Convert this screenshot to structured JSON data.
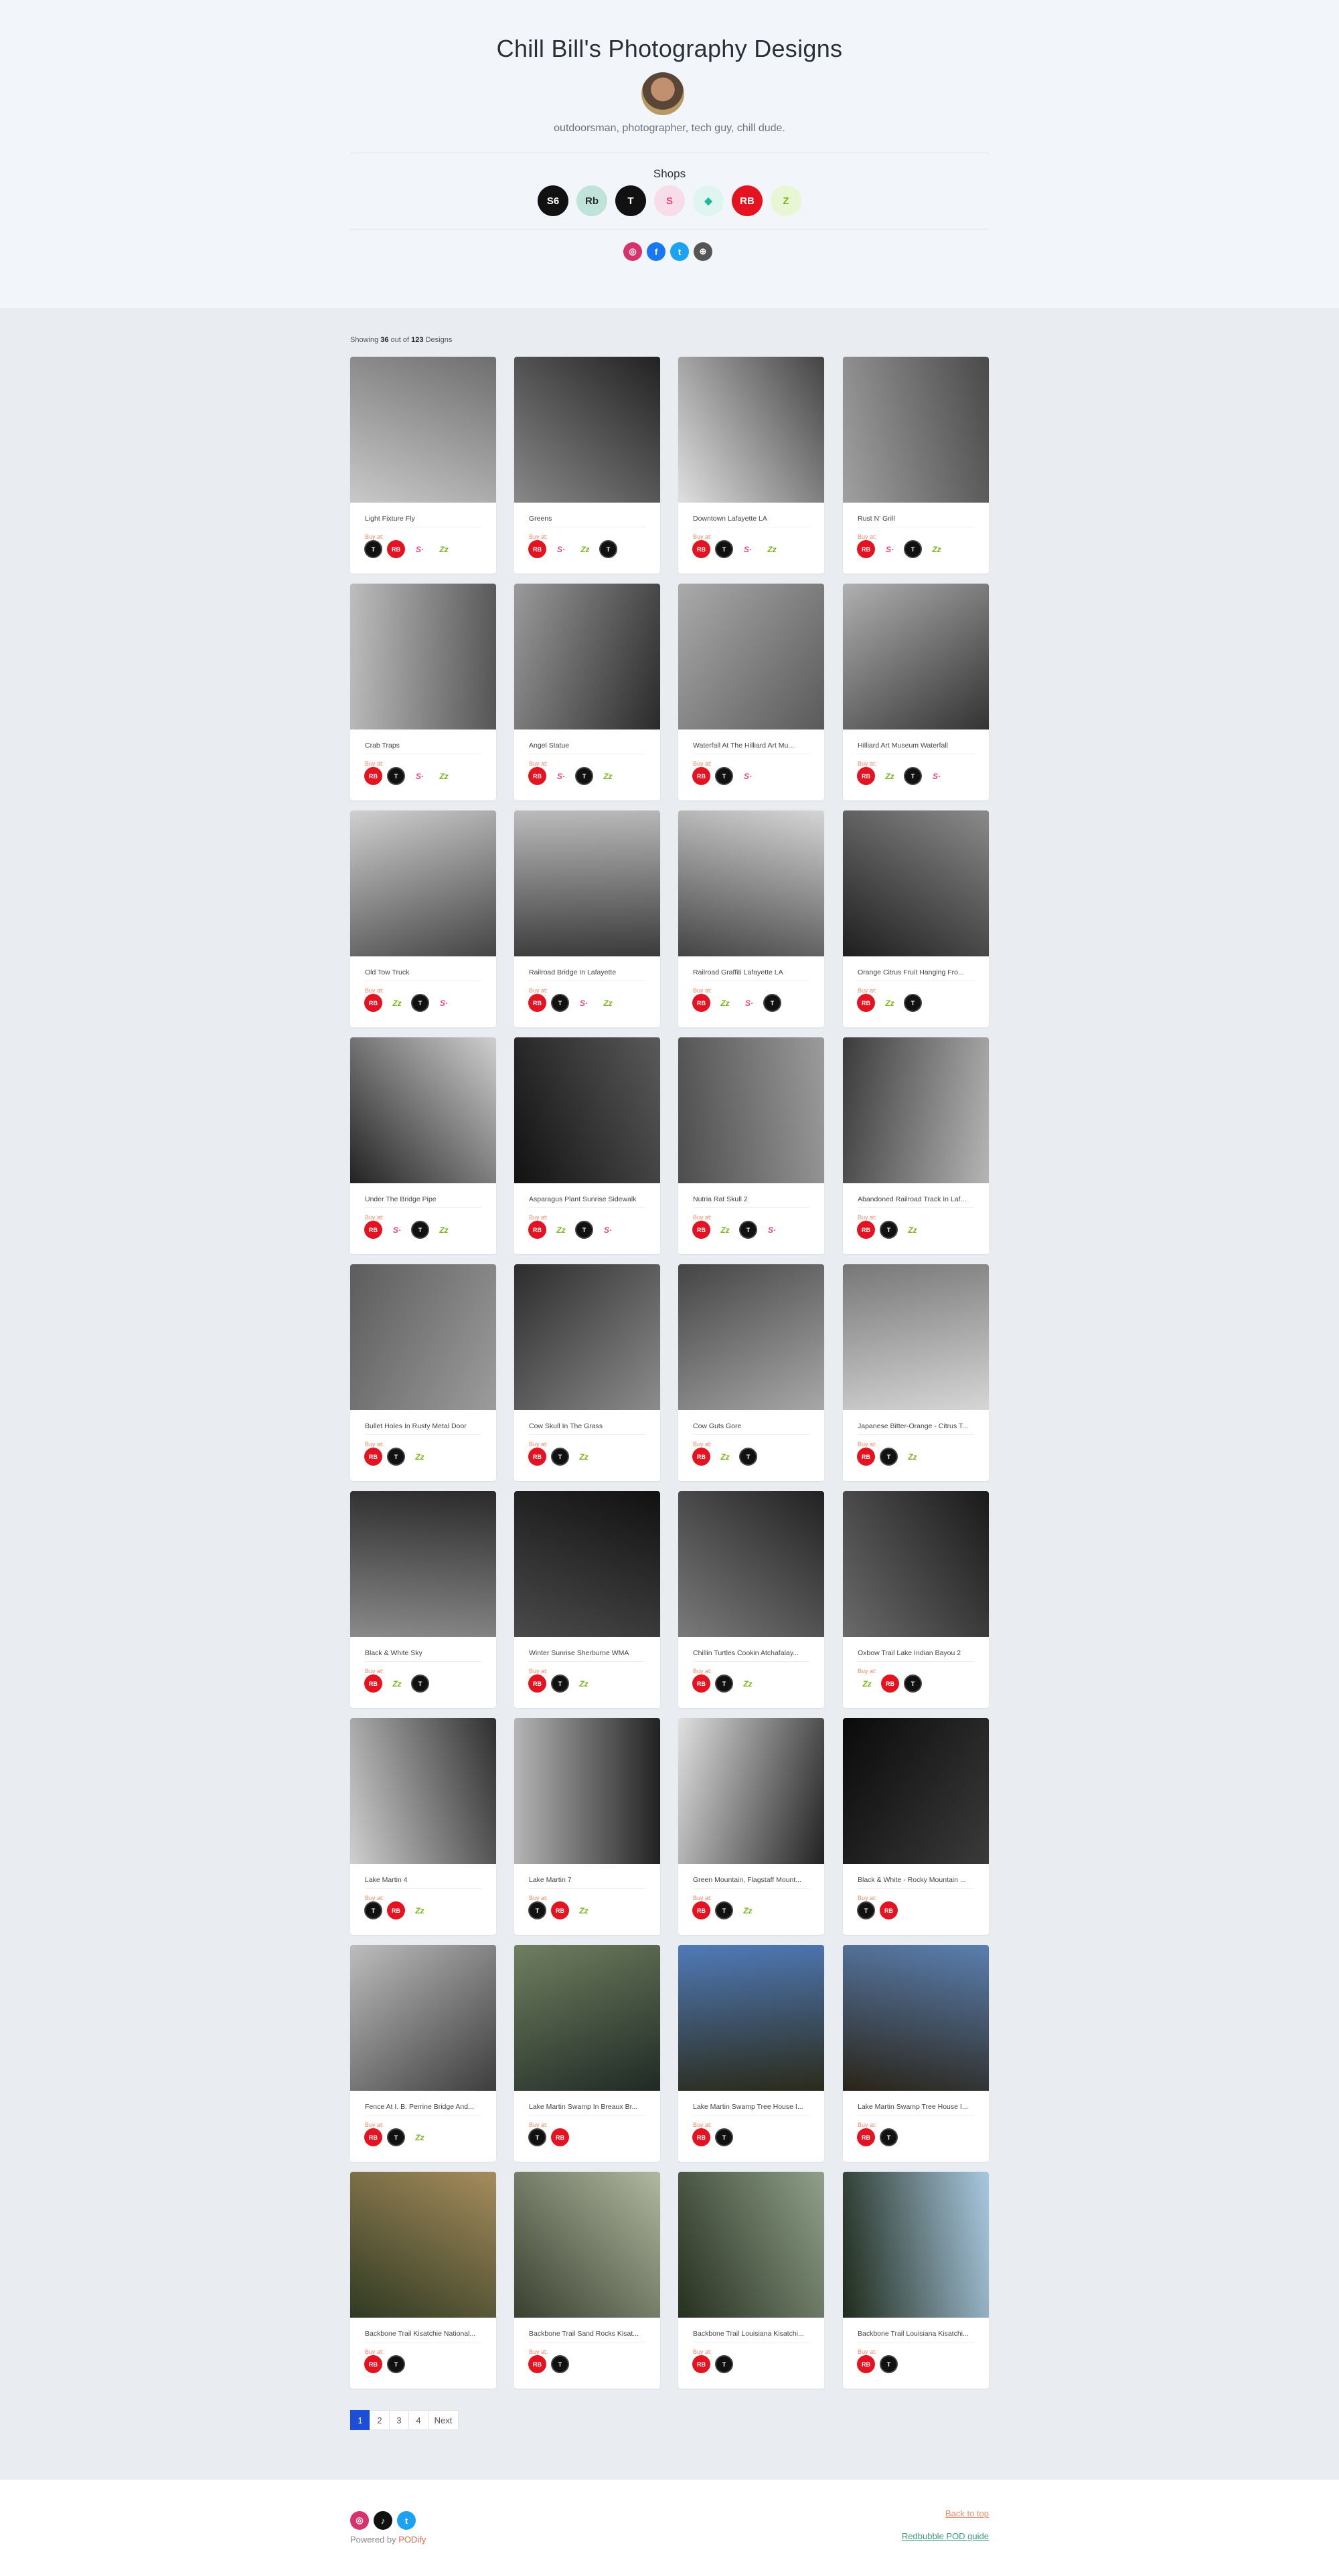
{
  "header": {
    "title": "Chill Bill's Photography Designs",
    "tagline": "outdoorsman, photographer, tech guy, chill dude.",
    "shops_title": "Shops",
    "shops": [
      {
        "name": "society6",
        "label": "S6",
        "bg": "#111111",
        "fg": "#ffffff"
      },
      {
        "name": "redbubble-retro",
        "label": "Rb",
        "bg": "#bfe3d8",
        "fg": "#2a2a2a"
      },
      {
        "name": "teepublic",
        "label": "T",
        "bg": "#111111",
        "fg": "#ffffff"
      },
      {
        "name": "spreadshirt",
        "label": "S",
        "bg": "#f6dde8",
        "fg": "#e8467c"
      },
      {
        "name": "teespring",
        "label": "◆",
        "bg": "#dff6f0",
        "fg": "#1db8a0"
      },
      {
        "name": "redbubble",
        "label": "RB",
        "bg": "#e41321",
        "fg": "#ffffff"
      },
      {
        "name": "zazzle",
        "label": "Z",
        "bg": "#e9f6d4",
        "fg": "#7ab51d"
      }
    ],
    "socials": [
      {
        "name": "instagram-icon",
        "glyph": "◎",
        "bg": "#d6336c"
      },
      {
        "name": "facebook-icon",
        "glyph": "f",
        "bg": "#1877f2"
      },
      {
        "name": "twitter-icon",
        "glyph": "t",
        "bg": "#1da1f2"
      },
      {
        "name": "website-icon",
        "glyph": "⊕",
        "bg": "#555555"
      }
    ]
  },
  "showing": {
    "prefix": "Showing ",
    "count": "36",
    "middle": " out of ",
    "total": "123",
    "suffix": " Designs"
  },
  "buy_label": "Buy at:",
  "cards": [
    {
      "title": "Light Fixture Fly",
      "shops": [
        "tp",
        "rb",
        "sp",
        "zz"
      ],
      "tone": [
        "#c9c9c9",
        "#6e6e6e"
      ]
    },
    {
      "title": "Greens",
      "shops": [
        "rb",
        "sp",
        "zz",
        "tp"
      ],
      "tone": [
        "#888",
        "#222"
      ]
    },
    {
      "title": "Downtown Lafayette LA",
      "shops": [
        "rb",
        "tp",
        "sp",
        "zz"
      ],
      "tone": [
        "#e0e0e0",
        "#444"
      ]
    },
    {
      "title": "Rust N' Grill",
      "shops": [
        "rb",
        "sp",
        "tp",
        "zz"
      ],
      "tone": [
        "#a0a0a0",
        "#4a4a4a"
      ]
    },
    {
      "title": "Crab Traps",
      "shops": [
        "rb",
        "tp",
        "sp",
        "zz"
      ],
      "tone": [
        "#bdbdbd",
        "#555"
      ]
    },
    {
      "title": "Angel Statue",
      "shops": [
        "rb",
        "sp",
        "tp",
        "zz"
      ],
      "tone": [
        "#9a9a9a",
        "#2a2a2a"
      ]
    },
    {
      "title": "Waterfall At The Hilliard Art Mu...",
      "shops": [
        "rb",
        "tp",
        "sp"
      ],
      "tone": [
        "#aaaaaa",
        "#5a5a5a"
      ]
    },
    {
      "title": "Hilliard Art Museum Waterfall",
      "shops": [
        "rb",
        "zz",
        "tp",
        "sp"
      ],
      "tone": [
        "#b0b0b0",
        "#333"
      ]
    },
    {
      "title": "Old Tow Truck",
      "shops": [
        "rb",
        "zz",
        "tp",
        "sp"
      ],
      "tone": [
        "#d0d0d0",
        "#444"
      ]
    },
    {
      "title": "Railroad Bridge In Lafayette",
      "shops": [
        "rb",
        "tp",
        "sp",
        "zz"
      ],
      "tone": [
        "#bbbbbb",
        "#3a3a3a"
      ]
    },
    {
      "title": "Railroad Graffiti Lafayette LA",
      "shops": [
        "rb",
        "zz",
        "sp",
        "tp"
      ],
      "tone": [
        "#d5d5d5",
        "#444"
      ]
    },
    {
      "title": "Orange Citrus Fruit Hanging Fro...",
      "shops": [
        "rb",
        "zz",
        "tp"
      ],
      "tone": [
        "#8a8a8a",
        "#1e1e1e"
      ]
    },
    {
      "title": "Under The Bridge Pipe",
      "shops": [
        "rb",
        "sp",
        "tp",
        "zz"
      ],
      "tone": [
        "#cfcfcf",
        "#222"
      ]
    },
    {
      "title": "Asparagus Plant Sunrise Sidewalk",
      "shops": [
        "rb",
        "zz",
        "tp",
        "sp"
      ],
      "tone": [
        "#5a5a5a",
        "#111"
      ]
    },
    {
      "title": "Nutria Rat Skull 2",
      "shops": [
        "rb",
        "zz",
        "tp",
        "sp"
      ],
      "tone": [
        "#9b9b9b",
        "#4d4d4d"
      ]
    },
    {
      "title": "Abandoned Railroad Track In Laf...",
      "shops": [
        "rb",
        "tp",
        "zz"
      ],
      "tone": [
        "#b5b5b5",
        "#3b3b3b"
      ]
    },
    {
      "title": "Bullet Holes In Rusty Metal Door",
      "shops": [
        "rb",
        "tp",
        "zz"
      ],
      "tone": [
        "#9c9c9c",
        "#5c5c5c"
      ]
    },
    {
      "title": "Cow Skull In The Grass",
      "shops": [
        "rb",
        "tp",
        "zz"
      ],
      "tone": [
        "#8c8c8c",
        "#2c2c2c"
      ]
    },
    {
      "title": "Cow Guts Gore",
      "shops": [
        "rb",
        "zz",
        "tp"
      ],
      "tone": [
        "#a8a8a8",
        "#444"
      ]
    },
    {
      "title": "Japanese Bitter-Orange - Citrus T...",
      "shops": [
        "rb",
        "tp",
        "zz"
      ],
      "tone": [
        "#d6d6d6",
        "#777"
      ]
    },
    {
      "title": "Black & White Sky",
      "shops": [
        "rb",
        "zz",
        "tp"
      ],
      "tone": [
        "#8a8a8a",
        "#2a2a2a"
      ]
    },
    {
      "title": "Winter Sunrise Sherburne WMA",
      "shops": [
        "rb",
        "tp",
        "zz"
      ],
      "tone": [
        "#4a4a4a",
        "#111"
      ]
    },
    {
      "title": "Chillin Turtles Cookin Atchafalay...",
      "shops": [
        "rb",
        "tp",
        "zz"
      ],
      "tone": [
        "#7a7a7a",
        "#222"
      ]
    },
    {
      "title": "Oxbow Trail Lake Indian Bayou 2",
      "shops": [
        "zz",
        "rb",
        "tp"
      ],
      "tone": [
        "#6a6a6a",
        "#1a1a1a"
      ]
    },
    {
      "title": "Lake Martin 4",
      "shops": [
        "tp",
        "rb",
        "zz"
      ],
      "tone": [
        "#cfcfcf",
        "#2f2f2f"
      ]
    },
    {
      "title": "Lake Martin 7",
      "shops": [
        "tp",
        "rb",
        "zz"
      ],
      "tone": [
        "#b5b5b5",
        "#222"
      ]
    },
    {
      "title": "Green Mountain, Flagstaff Mount...",
      "shops": [
        "rb",
        "tp",
        "zz"
      ],
      "tone": [
        "#e0e0e0",
        "#222"
      ]
    },
    {
      "title": "Black & White - Rocky Mountain ...",
      "shops": [
        "tp",
        "rb"
      ],
      "tone": [
        "#0a0a0a",
        "#3a3a3a"
      ]
    },
    {
      "title": "Fence At I. B. Perrine Bridge And...",
      "shops": [
        "rb",
        "tp",
        "zz"
      ],
      "tone": [
        "#bdbdbd",
        "#3d3d3d"
      ]
    },
    {
      "title": "Lake Martin Swamp In Breaux Br...",
      "shops": [
        "tp",
        "rb"
      ],
      "tone": [
        "#6f7f60",
        "#1f2a25"
      ]
    },
    {
      "title": "Lake Martin Swamp Tree House I...",
      "shops": [
        "rb",
        "tp"
      ],
      "tone": [
        "#4f7ab8",
        "#2b2b1a"
      ]
    },
    {
      "title": "Lake Martin Swamp Tree House I...",
      "shops": [
        "rb",
        "tp"
      ],
      "tone": [
        "#5a7fb0",
        "#2a2418"
      ]
    },
    {
      "title": "Backbone Trail Kisatchie National...",
      "shops": [
        "rb",
        "tp"
      ],
      "tone": [
        "#a68c5c",
        "#2f3a22"
      ]
    },
    {
      "title": "Backbone Trail Sand Rocks Kisat...",
      "shops": [
        "rb",
        "tp"
      ],
      "tone": [
        "#b0b8a0",
        "#3a4030"
      ]
    },
    {
      "title": "Backbone Trail Louisiana Kisatchi...",
      "shops": [
        "rb",
        "tp"
      ],
      "tone": [
        "#8fa08a",
        "#26301f"
      ]
    },
    {
      "title": "Backbone Trail Louisiana Kisatchi...",
      "shops": [
        "rb",
        "tp"
      ],
      "tone": [
        "#a8c8e0",
        "#1f2a1a"
      ]
    }
  ],
  "pagination": {
    "pages": [
      "1",
      "2",
      "3",
      "4"
    ],
    "next": "Next",
    "current": "1"
  },
  "footer": {
    "powered_prefix": "Powered by ",
    "powered_link": "PODify",
    "back_to_top": "Back to top",
    "guide": "Redbubble POD guide",
    "socials": [
      {
        "name": "instagram-icon",
        "glyph": "◎",
        "bg": "#d6336c"
      },
      {
        "name": "tiktok-icon",
        "glyph": "♪",
        "bg": "#111111"
      },
      {
        "name": "twitter-icon",
        "glyph": "t",
        "bg": "#1da1f2"
      }
    ]
  },
  "badge_glyphs": {
    "tp": "T",
    "rb": "RB",
    "sp": "S·",
    "zz": "Zz"
  }
}
